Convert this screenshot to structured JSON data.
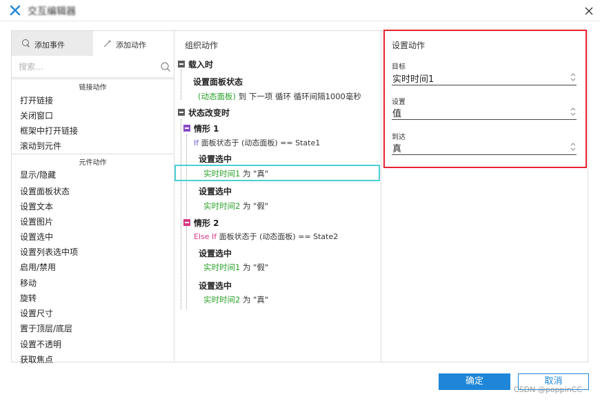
{
  "window": {
    "title": "交互编辑器",
    "close_icon": "close-icon"
  },
  "left": {
    "tab_events": "添加事件",
    "tab_actions": "添加动作",
    "search_placeholder": "搜索...",
    "section_links": "链接动作",
    "link_items": [
      "打开链接",
      "关闭窗口",
      "框架中打开链接",
      "滚动到元件"
    ],
    "section_widgets": "元件动作",
    "widget_items": [
      "显示/隐藏",
      "设置面板状态",
      "设置文本",
      "设置图片",
      "设置选中",
      "设置列表选中项",
      "启用/禁用",
      "移动",
      "旋转",
      "设置尺寸",
      "置于顶层/底层",
      "设置不透明",
      "获取焦点"
    ]
  },
  "middle": {
    "title": "组织动作",
    "event_load": "载入时",
    "load_action_title": "设置面板状态",
    "load_action_target": "(动态面板)",
    "load_action_rest": " 到 下一项 循环 循环间隔1000毫秒",
    "event_change": "状态改变时",
    "case1_name": "情形 1",
    "case1_kw": "If",
    "case1_cond": " 面板状态于 (动态面板) == State1",
    "case1_a1_title": "设置选中",
    "case1_a1_target": "实时时间1",
    "case1_a1_rest": " 为 \"真\"",
    "case1_a2_title": "设置选中",
    "case1_a2_target": "实时时间2",
    "case1_a2_rest": " 为 \"假\"",
    "case2_name": "情形 2",
    "case2_kw": "Else If",
    "case2_cond": " 面板状态于 (动态面板) == State2",
    "case2_a1_title": "设置选中",
    "case2_a1_target": "实时时间1",
    "case2_a1_rest": " 为 \"假\"",
    "case2_a2_title": "设置选中",
    "case2_a2_target": "实时时间2",
    "case2_a2_rest": " 为 \"真\""
  },
  "right": {
    "title": "设置动作",
    "target_label": "目标",
    "target_value": "实时时间1",
    "setting_label": "设置",
    "setting_value": "值",
    "to_label": "到达",
    "to_value": "真"
  },
  "buttons": {
    "ok": "确定",
    "cancel": "取消"
  },
  "watermark": "CSDN @poppinCC",
  "colors": {
    "accent": "#1e86d8",
    "selection": "#49cfd2",
    "highlight": "#e8212d",
    "green_target": "#2aa02a"
  }
}
